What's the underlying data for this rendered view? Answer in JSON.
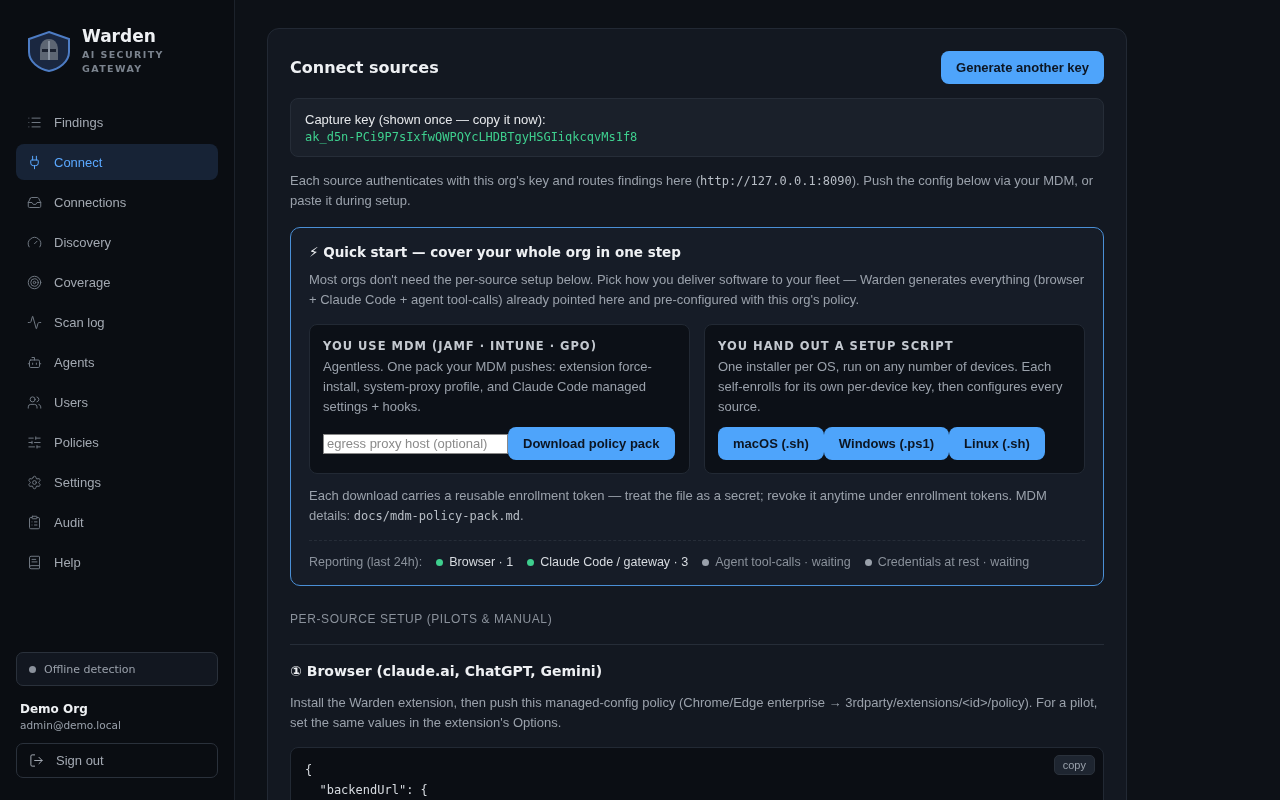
{
  "brand": {
    "name": "Warden",
    "tagline": "AI SECURITY GATEWAY"
  },
  "nav": [
    {
      "label": "Findings",
      "selected": false
    },
    {
      "label": "Connect",
      "selected": true
    },
    {
      "label": "Connections",
      "selected": false
    },
    {
      "label": "Discovery",
      "selected": false
    },
    {
      "label": "Coverage",
      "selected": false
    },
    {
      "label": "Scan log",
      "selected": false
    },
    {
      "label": "Agents",
      "selected": false
    },
    {
      "label": "Users",
      "selected": false
    },
    {
      "label": "Policies",
      "selected": false
    },
    {
      "label": "Settings",
      "selected": false
    },
    {
      "label": "Audit",
      "selected": false
    },
    {
      "label": "Help",
      "selected": false
    }
  ],
  "detection": {
    "label": "Offline detection",
    "color": "#8b929c"
  },
  "account": {
    "org": "Demo Org",
    "email": "admin@demo.local",
    "sign_out": "Sign out"
  },
  "page": {
    "title": "Connect sources",
    "action": "Generate another key",
    "key_box": {
      "label": "Capture key (shown once — copy it now):",
      "key": "ak_d5n-PCi9P7sIxfwQWPQYcLHDBTgyHSGIiqkcqvMs1f8"
    },
    "intro": [
      {
        "kind": "text",
        "text": "Each source authenticates with this org's key and routes findings here ("
      },
      {
        "kind": "code",
        "text": "http://127.0.0.1:8090"
      },
      {
        "kind": "text",
        "text": "). Push the config below via your MDM, or paste it during setup."
      }
    ],
    "quick_start": {
      "title": "⚡ Quick start — cover your whole org in one step",
      "description": "Most orgs don't need the per-source setup below. Pick how you deliver software to your fleet — Warden generates everything (browser + Claude Code + agent tool-calls) already pointed here and pre-configured with this org's policy.",
      "options": [
        {
          "kind": "mdm",
          "heading": "YOU USE MDM (JAMF · INTUNE · GPO)",
          "text": "Agentless. One pack your MDM pushes: extension force-install, system-proxy profile, and Claude Code managed settings + hooks.",
          "placeholder": "egress proxy host (optional)",
          "buttons": [
            "Download policy pack"
          ]
        },
        {
          "kind": "script",
          "heading": "YOU HAND OUT A SETUP SCRIPT",
          "text": "One installer per OS, run on any number of devices. Each self-enrolls for its own per-device key, then configures every source.",
          "buttons": [
            "macOS (.sh)",
            "Windows (.ps1)",
            "Linux (.sh)"
          ]
        }
      ],
      "note": [
        {
          "kind": "text",
          "text": "Each download carries a reusable enrollment token — treat the file as a secret; revoke it anytime under enrollment tokens. MDM details: "
        },
        {
          "kind": "code",
          "text": "docs/mdm-policy-pack.md"
        },
        {
          "kind": "text",
          "text": "."
        }
      ],
      "reporting_label": "Reporting (last 24h):",
      "reporting": [
        {
          "label": "Browser · 1",
          "color": "#3ecf8e",
          "active": true
        },
        {
          "label": "Claude Code / gateway · 3",
          "color": "#3ecf8e",
          "active": true
        },
        {
          "label": "Agent tool-calls · waiting",
          "color": "#9aa1ab",
          "active": false
        },
        {
          "label": "Credentials at rest · waiting",
          "color": "#9aa1ab",
          "active": false
        }
      ]
    },
    "section_label": "PER-SOURCE SETUP (PILOTS & MANUAL)",
    "browser": {
      "title": "① Browser (claude.ai, ChatGPT, Gemini)",
      "description": "Install the Warden extension, then push this managed-config policy (Chrome/Edge enterprise → 3rdparty/extensions/<id>/policy). For a pilot, set the same values in the extension's Options.",
      "copy": "copy",
      "code_lines": [
        "{",
        "  \"backendUrl\": {"
      ]
    }
  }
}
